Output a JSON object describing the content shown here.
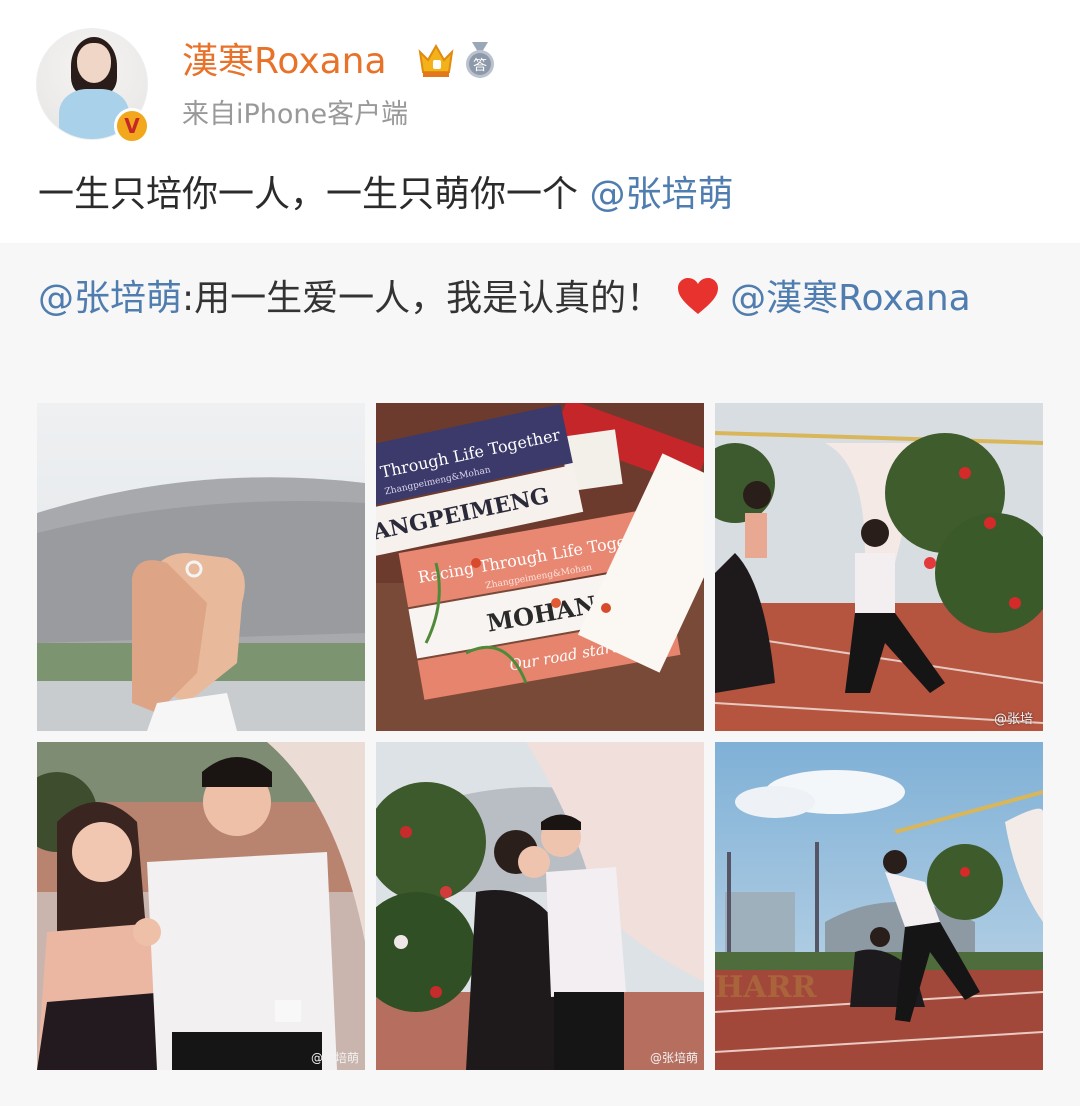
{
  "user": {
    "name": "漢寒Roxana",
    "source": "来自iPhone客户端",
    "verified_badge": "V",
    "level_badge": "答"
  },
  "post": {
    "text": "一生只培你一人，一生只萌你一个 ",
    "mention": "@张培萌"
  },
  "repost": {
    "author_mention": "@张培萌",
    "text": ":用一生爱一人，我是认真的！",
    "trailing_mention": "@漢寒Roxana"
  },
  "photos": {
    "p2_banner_top": "Through Life Together",
    "p2_banner_top_sub": "Zhangpeimeng&Mohan",
    "p2_name1": "ANGPEIMENG",
    "p2_banner_mid": "Racing Through Life Together",
    "p2_banner_mid_sub": "Zhangpeimeng&Mohan",
    "p2_name2": "MOHAN",
    "p2_script": "Our road starts",
    "p6_letters": "HARR",
    "watermark_p3": "@张培",
    "watermark_p4": "@张培萌",
    "watermark_p5": "@张培萌"
  },
  "colors": {
    "username": "#e8722a",
    "mention": "#507daf",
    "repost_bg": "#f7f7f7",
    "heart": "#e8322e"
  }
}
